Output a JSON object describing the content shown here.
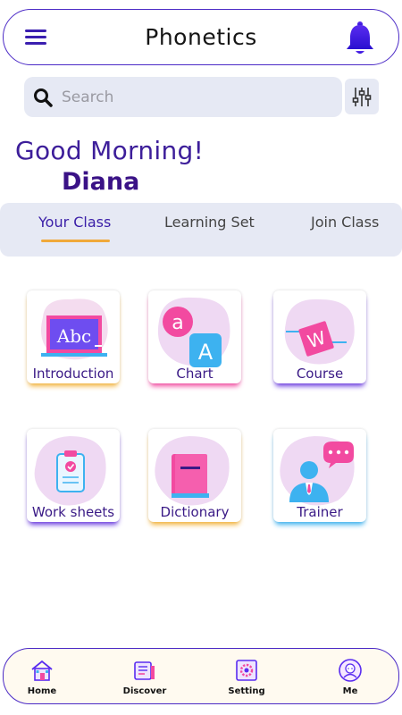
{
  "header": {
    "title": "Phonetics",
    "menu_icon": "hamburger-menu-icon",
    "bell_icon": "bell-icon"
  },
  "search": {
    "placeholder": "Search",
    "value": ""
  },
  "greeting": {
    "text": "Good Morning!",
    "name": "Diana"
  },
  "tabs": [
    {
      "label": "Your Class",
      "active": true
    },
    {
      "label": "Learning Set",
      "active": false
    },
    {
      "label": "Join Class",
      "active": false
    }
  ],
  "cards": [
    {
      "label": "Introduction",
      "icon": "blackboard-abc-icon"
    },
    {
      "label": "Chart",
      "icon": "letter-a-chart-icon"
    },
    {
      "label": "Course",
      "icon": "course-w-icon"
    },
    {
      "label": "Work sheets",
      "icon": "clipboard-worksheet-icon"
    },
    {
      "label": "Dictionary",
      "icon": "book-dictionary-icon"
    },
    {
      "label": "Trainer",
      "icon": "trainer-person-icon"
    }
  ],
  "board_text": "Abc",
  "chart_letters": {
    "small": "a",
    "big": "A"
  },
  "course_letter": "W",
  "bottom_nav": [
    {
      "label": "Home",
      "icon": "home-icon"
    },
    {
      "label": "Discover",
      "icon": "discover-icon"
    },
    {
      "label": "Setting",
      "icon": "settings-gear-icon"
    },
    {
      "label": "Me",
      "icon": "profile-avatar-icon"
    }
  ],
  "colors": {
    "accent": "#3b1fb0",
    "tab_underline": "#f0a93b",
    "pink": "#f24aa0",
    "blue": "#3db2f0",
    "orange": "#f3b33a"
  }
}
